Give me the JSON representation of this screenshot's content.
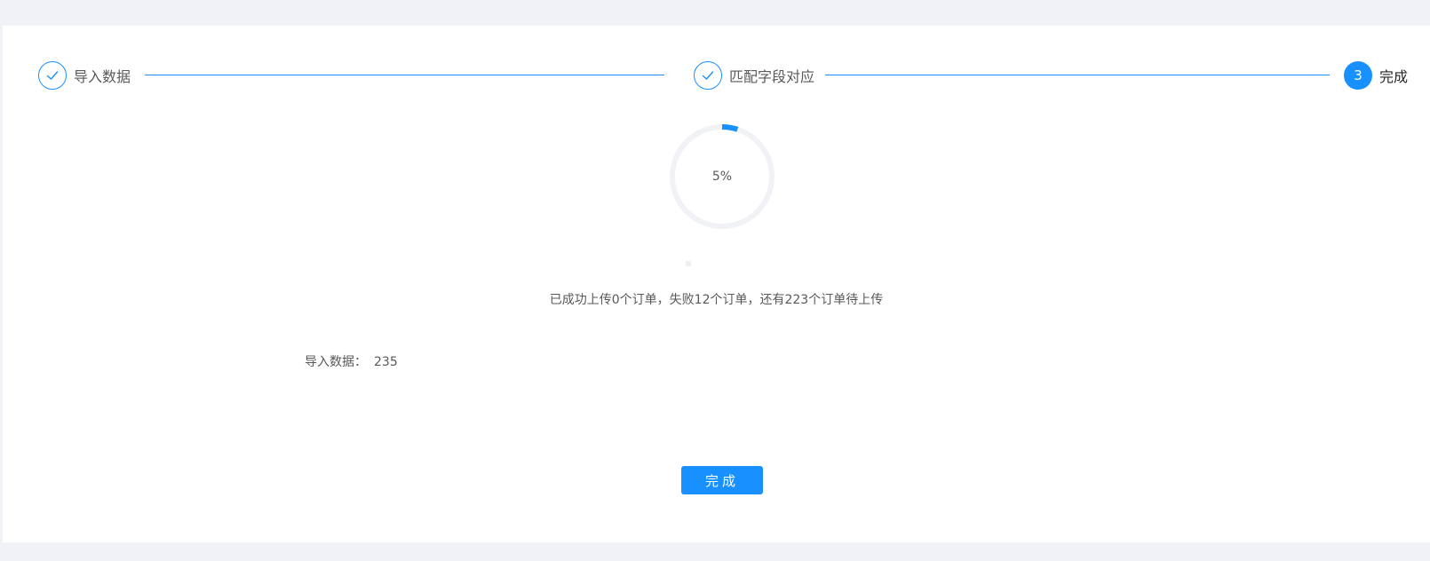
{
  "steps": [
    {
      "title": "导入数据",
      "status": "done"
    },
    {
      "title": "匹配字段对应",
      "status": "done"
    },
    {
      "number": "3",
      "title": "完成",
      "status": "active"
    }
  ],
  "progress": {
    "percent": 5,
    "label": "5%"
  },
  "status_message": "已成功上传0个订单，失败12个订单，还有223个订单待上传",
  "import_data": {
    "label": "导入数据：",
    "value": "235"
  },
  "finish_button": {
    "label": "完成"
  },
  "colors": {
    "primary": "#1890ff",
    "track": "#f0f2f5",
    "page_bg": "#f0f2f5",
    "text": "#595959"
  },
  "icons": {
    "done": "check-icon"
  }
}
